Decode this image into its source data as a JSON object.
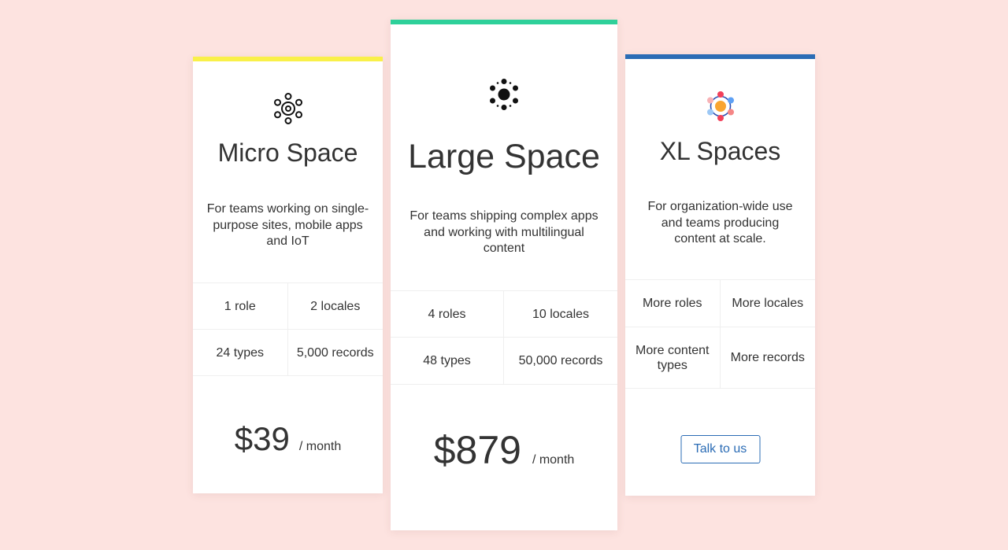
{
  "colors": {
    "background": "#fde3e0",
    "micro_accent": "#f9f049",
    "large_accent": "#2ed09a",
    "xl_accent": "#2b6cb5",
    "button": "#2b6cb5"
  },
  "plans": [
    {
      "icon": "molecule-outline-icon",
      "title": "Micro Space",
      "description": "For teams working on single-purpose sites, mobile apps and IoT",
      "features": [
        "1 role",
        "2 locales",
        "24 types",
        "5,000 records"
      ],
      "price": "$39",
      "period": "/ month"
    },
    {
      "icon": "molecule-filled-icon",
      "title": "Large Space",
      "description": "For teams shipping complex apps and working with multilingual content",
      "features": [
        "4 roles",
        "10 locales",
        "48 types",
        "50,000 records"
      ],
      "price": "$879",
      "period": "/ month"
    },
    {
      "icon": "molecule-color-icon",
      "title": "XL Spaces",
      "description": "For organization-wide use and teams producing content at scale.",
      "features": [
        "More roles",
        "More locales",
        "More content types",
        "More records"
      ],
      "cta_label": "Talk to us"
    }
  ]
}
